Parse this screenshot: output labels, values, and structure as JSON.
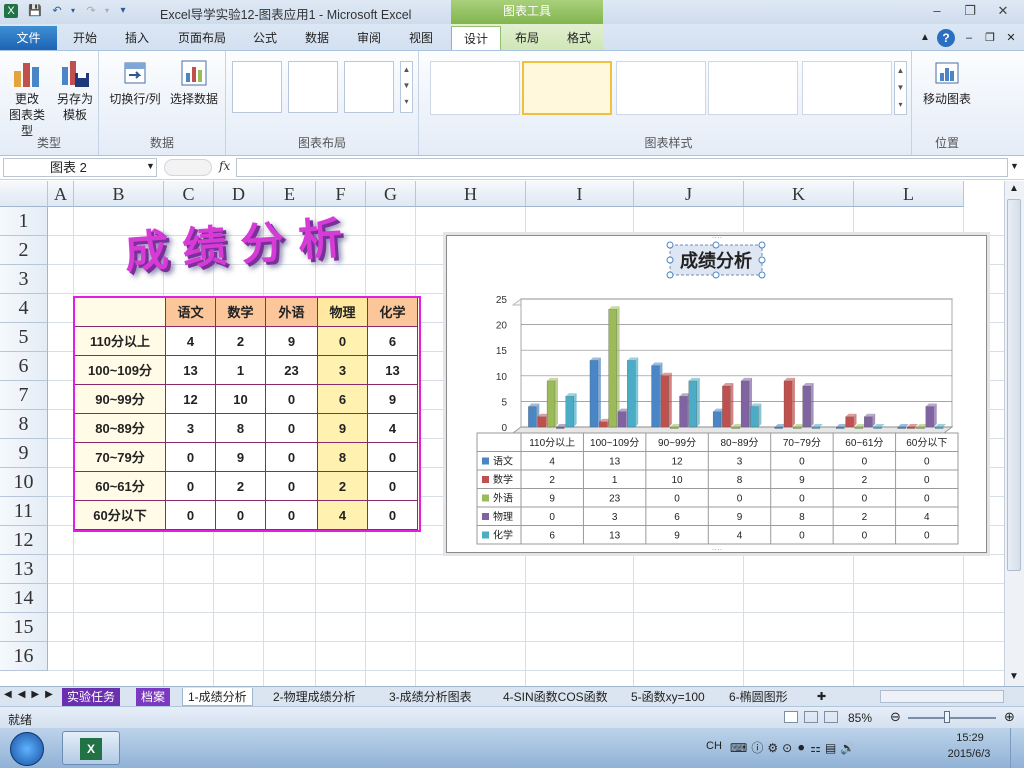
{
  "window": {
    "title": "Excel导学实验12-图表应用1 - Microsoft Excel",
    "context_tab_group": "图表工具"
  },
  "tabs": [
    "文件",
    "开始",
    "插入",
    "页面布局",
    "公式",
    "数据",
    "审阅",
    "视图",
    "设计",
    "布局",
    "格式"
  ],
  "ribbon": {
    "groups": {
      "type": "类型",
      "data": "数据",
      "layout": "图表布局",
      "styles": "图表样式",
      "location": "位置"
    },
    "buttons": {
      "change_type_1": "更改",
      "change_type_2": "图表类型",
      "save_template_1": "另存为",
      "save_template_2": "模板",
      "switch_row_col": "切换行/列",
      "select_data": "选择数据",
      "move_chart": "移动图表"
    }
  },
  "formula_bar": {
    "name_box": "图表 2",
    "fx": "fx",
    "formula": ""
  },
  "columns": [
    "A",
    "B",
    "C",
    "D",
    "E",
    "F",
    "G",
    "H",
    "I",
    "J",
    "K",
    "L"
  ],
  "rows": [
    "1",
    "2",
    "3",
    "4",
    "5",
    "6",
    "7",
    "8",
    "9",
    "10",
    "11",
    "12",
    "13",
    "14",
    "15",
    "16"
  ],
  "wordart": "成绩分析",
  "table": {
    "headers": [
      "语文",
      "数学",
      "外语",
      "物理",
      "化学"
    ],
    "rows": [
      {
        "label": "110分以上",
        "values": [
          "4",
          "2",
          "9",
          "0",
          "6"
        ]
      },
      {
        "label": "100~109分",
        "values": [
          "13",
          "1",
          "23",
          "3",
          "13"
        ]
      },
      {
        "label": "90~99分",
        "values": [
          "12",
          "10",
          "0",
          "6",
          "9"
        ]
      },
      {
        "label": "80~89分",
        "values": [
          "3",
          "8",
          "0",
          "9",
          "4"
        ]
      },
      {
        "label": "70~79分",
        "values": [
          "0",
          "9",
          "0",
          "8",
          "0"
        ]
      },
      {
        "label": "60~61分",
        "values": [
          "0",
          "2",
          "0",
          "2",
          "0"
        ]
      },
      {
        "label": "60分以下",
        "values": [
          "0",
          "0",
          "0",
          "4",
          "0"
        ]
      }
    ]
  },
  "chart_data": {
    "type": "bar",
    "title": "成绩分析",
    "categories": [
      "110分以上",
      "100~109分",
      "90~99分",
      "80~89分",
      "70~79分",
      "60~61分",
      "60分以下"
    ],
    "series": [
      {
        "name": "语文",
        "values": [
          4,
          13,
          12,
          3,
          0,
          0,
          0
        ],
        "color": "#4a86c5"
      },
      {
        "name": "数学",
        "values": [
          2,
          1,
          10,
          8,
          9,
          2,
          0
        ],
        "color": "#c0504d"
      },
      {
        "name": "外语",
        "values": [
          9,
          23,
          0,
          0,
          0,
          0,
          0
        ],
        "color": "#9bbb59"
      },
      {
        "name": "物理",
        "values": [
          0,
          3,
          6,
          9,
          8,
          2,
          4
        ],
        "color": "#8064a2"
      },
      {
        "name": "化学",
        "values": [
          6,
          13,
          9,
          4,
          0,
          0,
          0
        ],
        "color": "#4bacc6"
      }
    ],
    "yticks": [
      "0",
      "5",
      "10",
      "15",
      "20",
      "25"
    ],
    "ylim": [
      0,
      25
    ],
    "grid": true,
    "legend": "data-table"
  },
  "sheet_tabs": [
    "实验任务",
    "档案",
    "1-成绩分析",
    "2-物理成绩分析",
    "3-成绩分析图表",
    "4-SIN函数COS函数",
    "5-函数xy=100",
    "6-椭圆图形"
  ],
  "status": {
    "ready": "就绪",
    "zoom": "85%"
  },
  "taskbar": {
    "lang": "CH",
    "time": "15:29",
    "date": "2015/6/3"
  }
}
